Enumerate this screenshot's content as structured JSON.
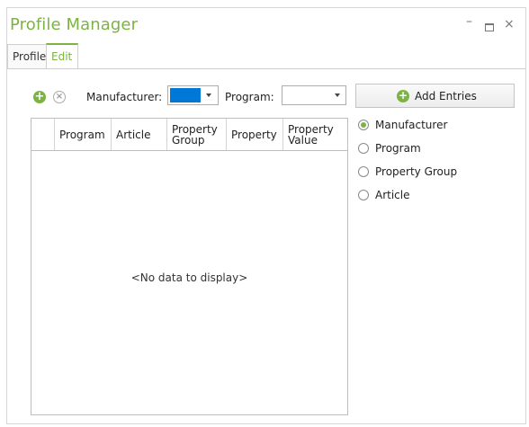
{
  "window": {
    "title": "Profile Manager",
    "minimize": "–",
    "close": "×"
  },
  "tabs": [
    {
      "label": "Profiles"
    },
    {
      "label": "Edit",
      "active": true
    }
  ],
  "toolbar": {
    "add_icon": "+",
    "remove_icon": "×",
    "manufacturer_label": "Manufacturer:",
    "manufacturer_color": "#0078d7",
    "program_label": "Program:",
    "program_value": "",
    "add_entries_label": "Add Entries"
  },
  "grid": {
    "columns": [
      "",
      "Program",
      "Article",
      "Property Group",
      "Property",
      "Property Value"
    ],
    "empty_text": "<No data to display>"
  },
  "radio_options": [
    {
      "label": "Manufacturer",
      "checked": true
    },
    {
      "label": "Program",
      "checked": false
    },
    {
      "label": "Property Group",
      "checked": false
    },
    {
      "label": "Article",
      "checked": false
    }
  ],
  "colors": {
    "accent": "#7cb342",
    "selection_blue": "#0078d7"
  }
}
